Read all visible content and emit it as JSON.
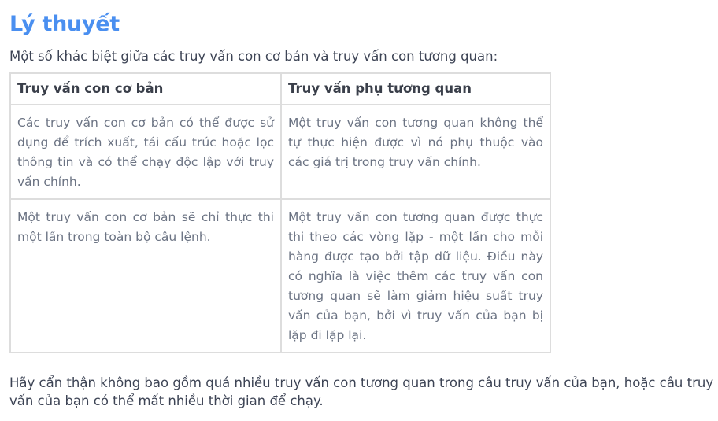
{
  "title": "Lý thuyết",
  "intro": "Một số khác biệt giữa các truy vấn con cơ bản và truy vấn con tương quan:",
  "table": {
    "headers": [
      "Truy vấn con cơ bản",
      "Truy vấn phụ tương quan"
    ],
    "rows": [
      [
        "Các truy vấn con cơ bản có thể được sử dụng để trích xuất, tái cấu trúc hoặc lọc thông tin và có thể chạy độc lập với truy vấn chính.",
        "Một truy vấn con tương quan không thể tự thực hiện được vì nó phụ thuộc vào các giá trị trong truy vấn chính."
      ],
      [
        "Một truy vấn con cơ bản sẽ chỉ thực thi một lần trong toàn bộ câu lệnh.",
        "Một truy vấn con tương quan được thực thi theo các vòng lặp - một lần cho mỗi hàng được tạo bởi tập dữ liệu. Điều này có nghĩa là việc thêm các truy vấn con tương quan sẽ làm giảm hiệu suất truy vấn của bạn, bởi vì truy vấn của bạn bị lặp đi lặp lại."
      ]
    ]
  },
  "note": "Hãy cẩn thận không bao gồm quá nhiều truy vấn con tương quan trong câu truy vấn của bạn, hoặc câu truy vấn của bạn có thể mất nhiều thời gian để chạy."
}
